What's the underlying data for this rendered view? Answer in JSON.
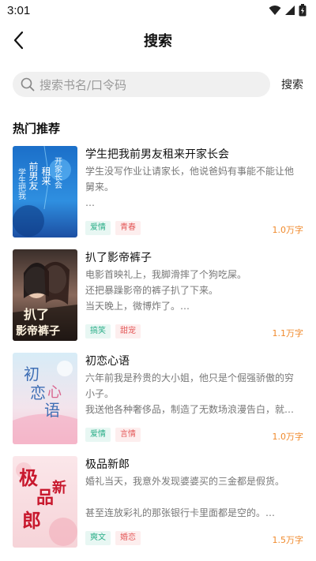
{
  "status_bar": {
    "time": "3:01"
  },
  "header": {
    "title": "搜索"
  },
  "search": {
    "placeholder": "搜索书名/口令码",
    "button_label": "搜索"
  },
  "section": {
    "title": "热门推荐"
  },
  "colors": {
    "tag_green": "#2bae88",
    "tag_red": "#e45a5a",
    "count": "#f08a2c"
  },
  "books": [
    {
      "title": "学生把我前男友租来开家长会",
      "desc": [
        "学生没写作业让请家长，他说爸妈有事能不能让他",
        "舅来。",
        "…"
      ],
      "tags": [
        "爱情",
        "青春"
      ],
      "count": "1.0万字",
      "cover_text": "学生把我前男友租来开家长会"
    },
    {
      "title": "扒了影帝裤子",
      "desc": [
        "电影首映礼上，我脚滑摔了个狗吃屎。",
        "还把暴躁影帝的裤子扒了下来。",
        "当天晚上，微博炸了。…"
      ],
      "tags": [
        "搞笑",
        "甜宠"
      ],
      "count": "1.1万字",
      "cover_text_1": "扒了",
      "cover_text_2": "影帝裤子"
    },
    {
      "title": "初恋心语",
      "desc": [
        "六年前我是矜贵的大小姐，他只是个倔强骄傲的穷",
        "小子。",
        "我送他各种奢侈品，制造了无数场浪漫告白，就…"
      ],
      "tags": [
        "爱情",
        "言情"
      ],
      "count": "1.0万字",
      "cover_text_1": "初",
      "cover_text_2": "恋",
      "cover_text_3": "心",
      "cover_text_4": "语"
    },
    {
      "title": "极品新郎",
      "desc": [
        "婚礼当天，我意外发现婆婆买的三金都是假货。",
        "",
        "甚至连放彩礼的那张银行卡里面都是空的。…"
      ],
      "tags": [
        "爽文",
        "婚恋"
      ],
      "count": "1.5万字",
      "cover_text_1": "极",
      "cover_text_2": "品",
      "cover_text_3": "新",
      "cover_text_4": "郎"
    }
  ]
}
